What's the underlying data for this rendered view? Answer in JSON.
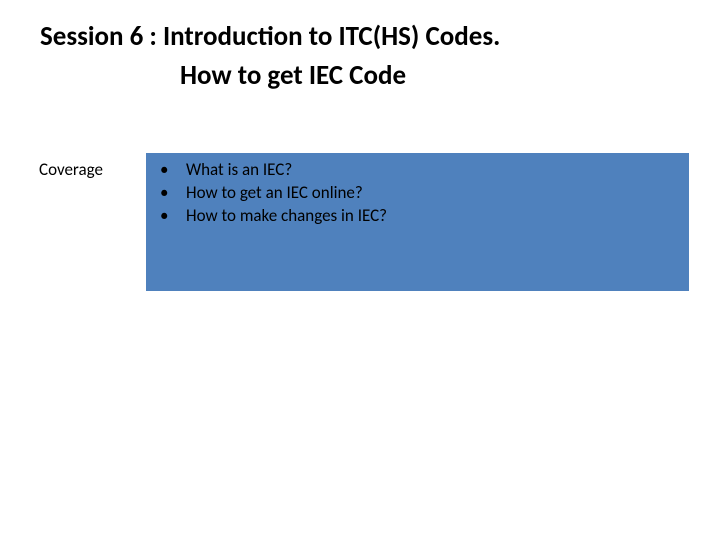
{
  "title_line1": "Session 6 : Introduction to ITC(HS) Codes.",
  "title_line2": "How to get IEC Code",
  "coverage_label": "Coverage",
  "bullets": {
    "b0": "What is an IEC?",
    "b1": "How to get an IEC online?",
    "b2": "How to make changes in IEC?"
  }
}
